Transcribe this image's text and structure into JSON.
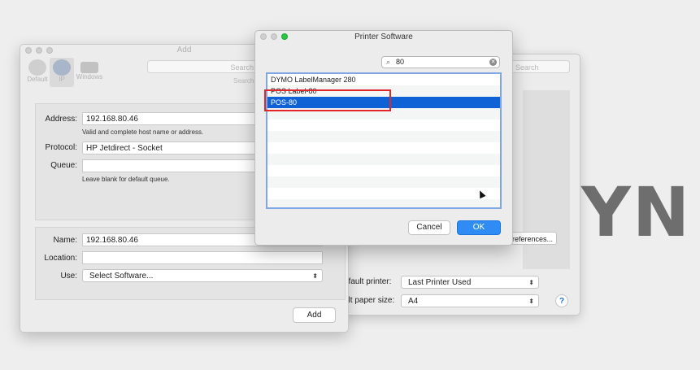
{
  "background": {
    "brand_text": "YN"
  },
  "prefs_window": {
    "search_placeholder": "Search",
    "preferences_button": "references...",
    "default_printer_label": "efault printer:",
    "default_printer_value": "Last Printer Used",
    "paper_size_label": "ult paper size:",
    "paper_size_value": "A4",
    "help_label": "?"
  },
  "add_window": {
    "title": "Add",
    "toolbar": [
      {
        "label": "Default",
        "icon": "default-printer-icon"
      },
      {
        "label": "IP",
        "icon": "globe-icon",
        "selected": true
      },
      {
        "label": "Windows",
        "icon": "windows-printer-icon"
      }
    ],
    "search_placeholder": "Search",
    "search_label": "Search",
    "address_label": "Address:",
    "address_value": "192.168.80.46",
    "address_hint": "Valid and complete host name or address.",
    "protocol_label": "Protocol:",
    "protocol_value": "HP Jetdirect - Socket",
    "queue_label": "Queue:",
    "queue_value": "",
    "queue_hint": "Leave blank for default queue.",
    "name_label": "Name:",
    "name_value": "192.168.80.46",
    "location_label": "Location:",
    "location_value": "",
    "use_label": "Use:",
    "use_value": "Select Software...",
    "add_button": "Add"
  },
  "printer_software": {
    "title": "Printer Software",
    "search_value": "80",
    "items": [
      "DYMO LabelManager 280",
      "POS Label-80",
      "POS-80"
    ],
    "selected_index": 2,
    "cancel_button": "Cancel",
    "ok_button": "OK"
  },
  "colors": {
    "accent": "#2f8cf5",
    "selection": "#0e62d6",
    "highlight": "#e0262b"
  }
}
